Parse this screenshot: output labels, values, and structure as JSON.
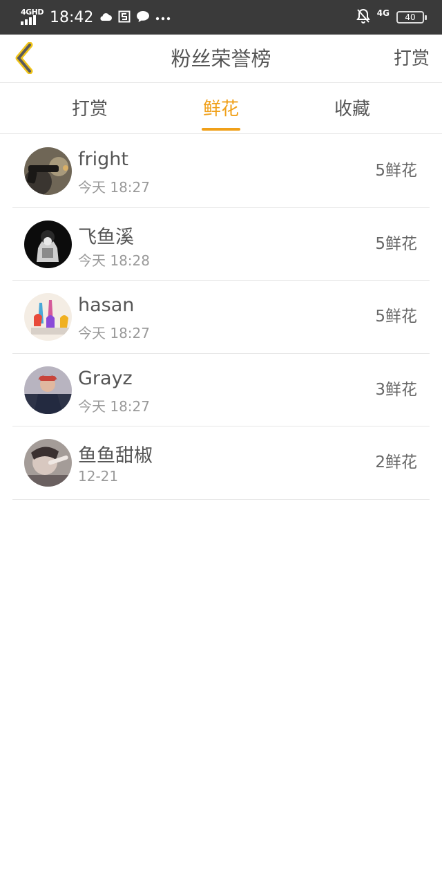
{
  "status_bar": {
    "network_label": "4GHD",
    "time": "18:42",
    "icons": [
      "cloud-icon",
      "s-app-icon",
      "chat-bubble-icon",
      "more-dots-icon"
    ],
    "right_network": "4G",
    "battery": "40"
  },
  "header": {
    "back_icon": "chevron-left-icon",
    "title": "粉丝荣誉榜",
    "action_label": "打赏",
    "accent_color": "#f0a019"
  },
  "tabs": [
    {
      "label": "打赏",
      "active": false
    },
    {
      "label": "鲜花",
      "active": true
    },
    {
      "label": "收藏",
      "active": false
    }
  ],
  "fans": [
    {
      "name": "fright",
      "time": "今天 18:27",
      "amount": "5鲜花"
    },
    {
      "name": "飞鱼溪",
      "time": "今天 18:28",
      "amount": "5鲜花"
    },
    {
      "name": "hasan",
      "time": "今天 18:27",
      "amount": "5鲜花"
    },
    {
      "name": "Grayz",
      "time": "今天 18:27",
      "amount": "3鲜花"
    },
    {
      "name": "鱼鱼甜椒",
      "time": "12-21",
      "amount": "2鲜花"
    }
  ]
}
